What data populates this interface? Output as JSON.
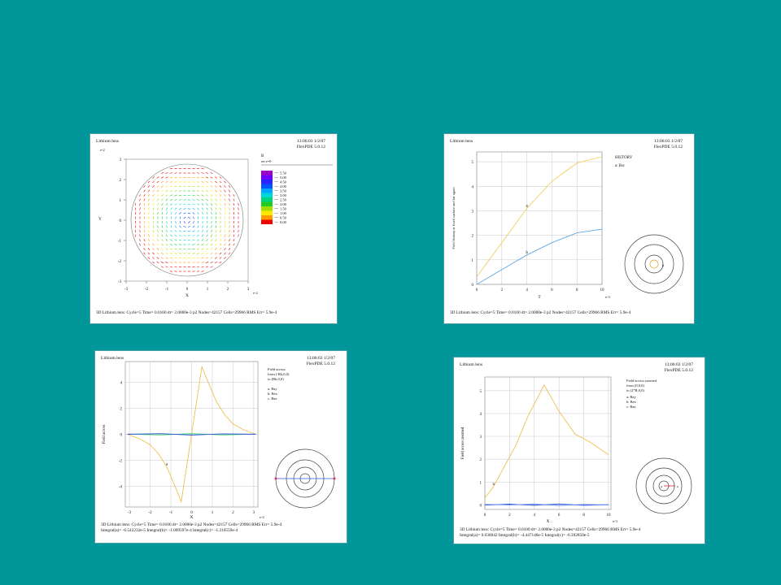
{
  "slide": {
    "background": "#00969a"
  },
  "panels": [
    {
      "title": "Lithium lens",
      "stamp": [
        "13:06:03 1/2/07",
        "FlexPDE 5.0.12"
      ],
      "footer": [
        "3D Lithium lens:  Cycle=5  Time= 0.0100  dt= 2.0000e-3  p2  Nodes=42157 Cells=29966 RMS Err= 5.9e-4"
      ],
      "legend": {
        "title": "B",
        "subtitle": "on z=0"
      }
    },
    {
      "title": "Lithium lens",
      "stamp": [
        "13:06:03 1/2/07",
        "FlexPDE 5.0.12"
      ],
      "footer": [
        "3D Lithium lens:  Cycle=5  Time= 0.0100  dt= 2.0000e-3  p2  Nodes=42157 Cells=29966 RMS Err= 5.9e-4"
      ],
      "legend": {
        "title": "HISTORY",
        "entries": [
          "a: Bsc"
        ]
      }
    },
    {
      "title": "Lithium lens",
      "stamp": [
        "13:06:03 1/2/07",
        "FlexPDE 5.0.12"
      ],
      "footer": [
        "3D Lithium lens:  Cycle=5  Time= 0.0100  dt= 2.0000e-3  p2  Nodes=42157 Cells=29966 RMS Err= 5.9e-4",
        "Integral(a)= -6.542232e-5  Integral(b)= -1.009597e-4  Integral(c)= -1.210559e-4"
      ],
      "legend": {
        "title": [
          "Field across",
          "from (-Rb,0,0)",
          "to (Rb,0,0)"
        ],
        "entries": [
          "a: Bay",
          "b: Bex",
          "c: Baz"
        ]
      }
    },
    {
      "title": "Lithium lens",
      "stamp": [
        "13:06:03 1/2/07",
        "FlexPDE 5.0.12"
      ],
      "footer": [
        "3D Lithium lens:  Cycle=5  Time= 0.0100  dt= 2.0000e-3  p2  Nodes=42157 Cells=29966 RMS Err= 5.9e-4",
        "Integral(a)= 0.030042  Integral(b)= -4.447146e-5  Integral(c)= -6.392850e-5"
      ],
      "legend": {
        "title": [
          "Field across zoomed",
          "from (0,0,0)",
          "to (2*R,0,0)"
        ],
        "entries": [
          "a: Bay",
          "b: Bex",
          "c: Baz"
        ]
      }
    }
  ],
  "chart_data": [
    {
      "type": "heatmap",
      "subtype": "vector-field",
      "title": "Lithium lens",
      "xlabel": "X",
      "ylabel": "Y",
      "xscale_note": "e-2",
      "yscale_note": "e-2",
      "xlim": [
        -3,
        3
      ],
      "ylim": [
        -3,
        3
      ],
      "xticks": [
        "-3",
        "-2",
        "-1",
        "0",
        "1",
        "2",
        "3"
      ],
      "yticks": [
        "3",
        "2",
        "1",
        "0",
        "-1",
        "-2",
        "-3"
      ],
      "colorbar": {
        "levels": [
          "5.50",
          "5.00",
          "4.50",
          "4.00",
          "3.50",
          "3.00",
          "2.50",
          "2.00",
          "1.50",
          "1.00",
          "0.50",
          "0.00"
        ],
        "colors": [
          "#9b00c4",
          "#6f00ff",
          "#2a22ff",
          "#0055ff",
          "#00a6ff",
          "#00d6d6",
          "#00d37a",
          "#22cc22",
          "#a6dc00",
          "#ffe800",
          "#ff9a00",
          "#f00000"
        ]
      },
      "grid": true
    },
    {
      "type": "line",
      "title": "Lithium lens",
      "xlabel": "T",
      "ylabel": "Field history at fixed surface and far again",
      "xscale_note": "e-3",
      "xlim": [
        0,
        10
      ],
      "ylim": [
        0,
        5.4
      ],
      "xticks": [
        "0",
        "2",
        "4",
        "6",
        "8",
        "10"
      ],
      "yticks": [
        "0",
        "1",
        "2",
        "3",
        "4",
        "5"
      ],
      "series": [
        {
          "name": "a: Bsc",
          "label": "a",
          "color": "#f0d060",
          "x": [
            0,
            2,
            4,
            6,
            8,
            10
          ],
          "values": [
            0.3,
            1.7,
            3.1,
            4.2,
            4.95,
            5.2
          ]
        },
        {
          "label": "b",
          "color": "#5fa8e8",
          "x": [
            0,
            2,
            4,
            6,
            8,
            10
          ],
          "values": [
            0.0,
            0.6,
            1.2,
            1.7,
            2.1,
            2.25
          ]
        }
      ],
      "grid": true,
      "legend": "top-right"
    },
    {
      "type": "line",
      "title": "Lithium lens",
      "xlabel": "X",
      "ylabel": "Field across",
      "xscale_note": "e-2",
      "xlim": [
        -3.2,
        3.2
      ],
      "ylim": [
        -5.6,
        5.6
      ],
      "xticks": [
        "-3",
        "-2",
        "-1",
        "0",
        "1",
        "2",
        "3"
      ],
      "yticks": [
        "4",
        "2",
        "0",
        "-2",
        "-4"
      ],
      "series": [
        {
          "name": "a: Bay",
          "label": "a",
          "color": "#f0c050",
          "x": [
            -3.1,
            -2.5,
            -2.0,
            -1.6,
            -1.2,
            -0.8,
            -0.5,
            0.0,
            0.5,
            0.8,
            1.2,
            1.6,
            2.0,
            2.5,
            3.1
          ],
          "values": [
            0.0,
            -0.35,
            -0.8,
            -1.5,
            -2.5,
            -4.0,
            -5.2,
            0.0,
            5.2,
            4.0,
            2.5,
            1.5,
            0.8,
            0.35,
            0.0
          ]
        },
        {
          "name": "b: Bex",
          "label": "b",
          "color": "#33cc66",
          "x": [
            -3.1,
            -1.5,
            0,
            1.5,
            3.1
          ],
          "values": [
            0.02,
            -0.05,
            0.05,
            -0.05,
            0.02
          ]
        },
        {
          "name": "c: Baz",
          "label": "c",
          "color": "#3355dd",
          "x": [
            -3.1,
            -1.5,
            0,
            1.5,
            3.1
          ],
          "values": [
            0.0,
            0.05,
            -0.06,
            0.04,
            0.0
          ]
        }
      ],
      "grid": true,
      "legend": "top-right"
    },
    {
      "type": "line",
      "title": "Lithium lens",
      "xlabel": "X",
      "ylabel": "Field across zoomed",
      "xscale_note": "e-3",
      "xlim": [
        0,
        10.2
      ],
      "ylim": [
        -0.2,
        5.6
      ],
      "xticks": [
        "0",
        "2",
        "4",
        "6",
        "8",
        "10"
      ],
      "yticks": [
        "0",
        "1",
        "2",
        "3",
        "4",
        "5"
      ],
      "series": [
        {
          "name": "a: Bay",
          "label": "a",
          "color": "#f0c050",
          "x": [
            0,
            0.7,
            1.5,
            2.5,
            3.5,
            4.8,
            6.0,
            7.3,
            8.5,
            10
          ],
          "values": [
            0.3,
            0.8,
            1.6,
            2.6,
            3.9,
            5.25,
            4.1,
            3.1,
            2.75,
            2.2
          ]
        },
        {
          "name": "b: Bex",
          "label": "b",
          "color": "#2255dd",
          "x": [
            0,
            2,
            4,
            6,
            8,
            10
          ],
          "values": [
            -0.01,
            0.03,
            -0.02,
            0.04,
            -0.02,
            0.01
          ]
        },
        {
          "name": "c: Baz",
          "label": "c",
          "color": "#6688ee",
          "x": [
            0,
            2,
            4,
            6,
            8,
            10
          ],
          "values": [
            0.02,
            0.0,
            0.03,
            -0.03,
            0.02,
            0.0
          ]
        }
      ],
      "grid": true,
      "legend": "top-right"
    }
  ]
}
